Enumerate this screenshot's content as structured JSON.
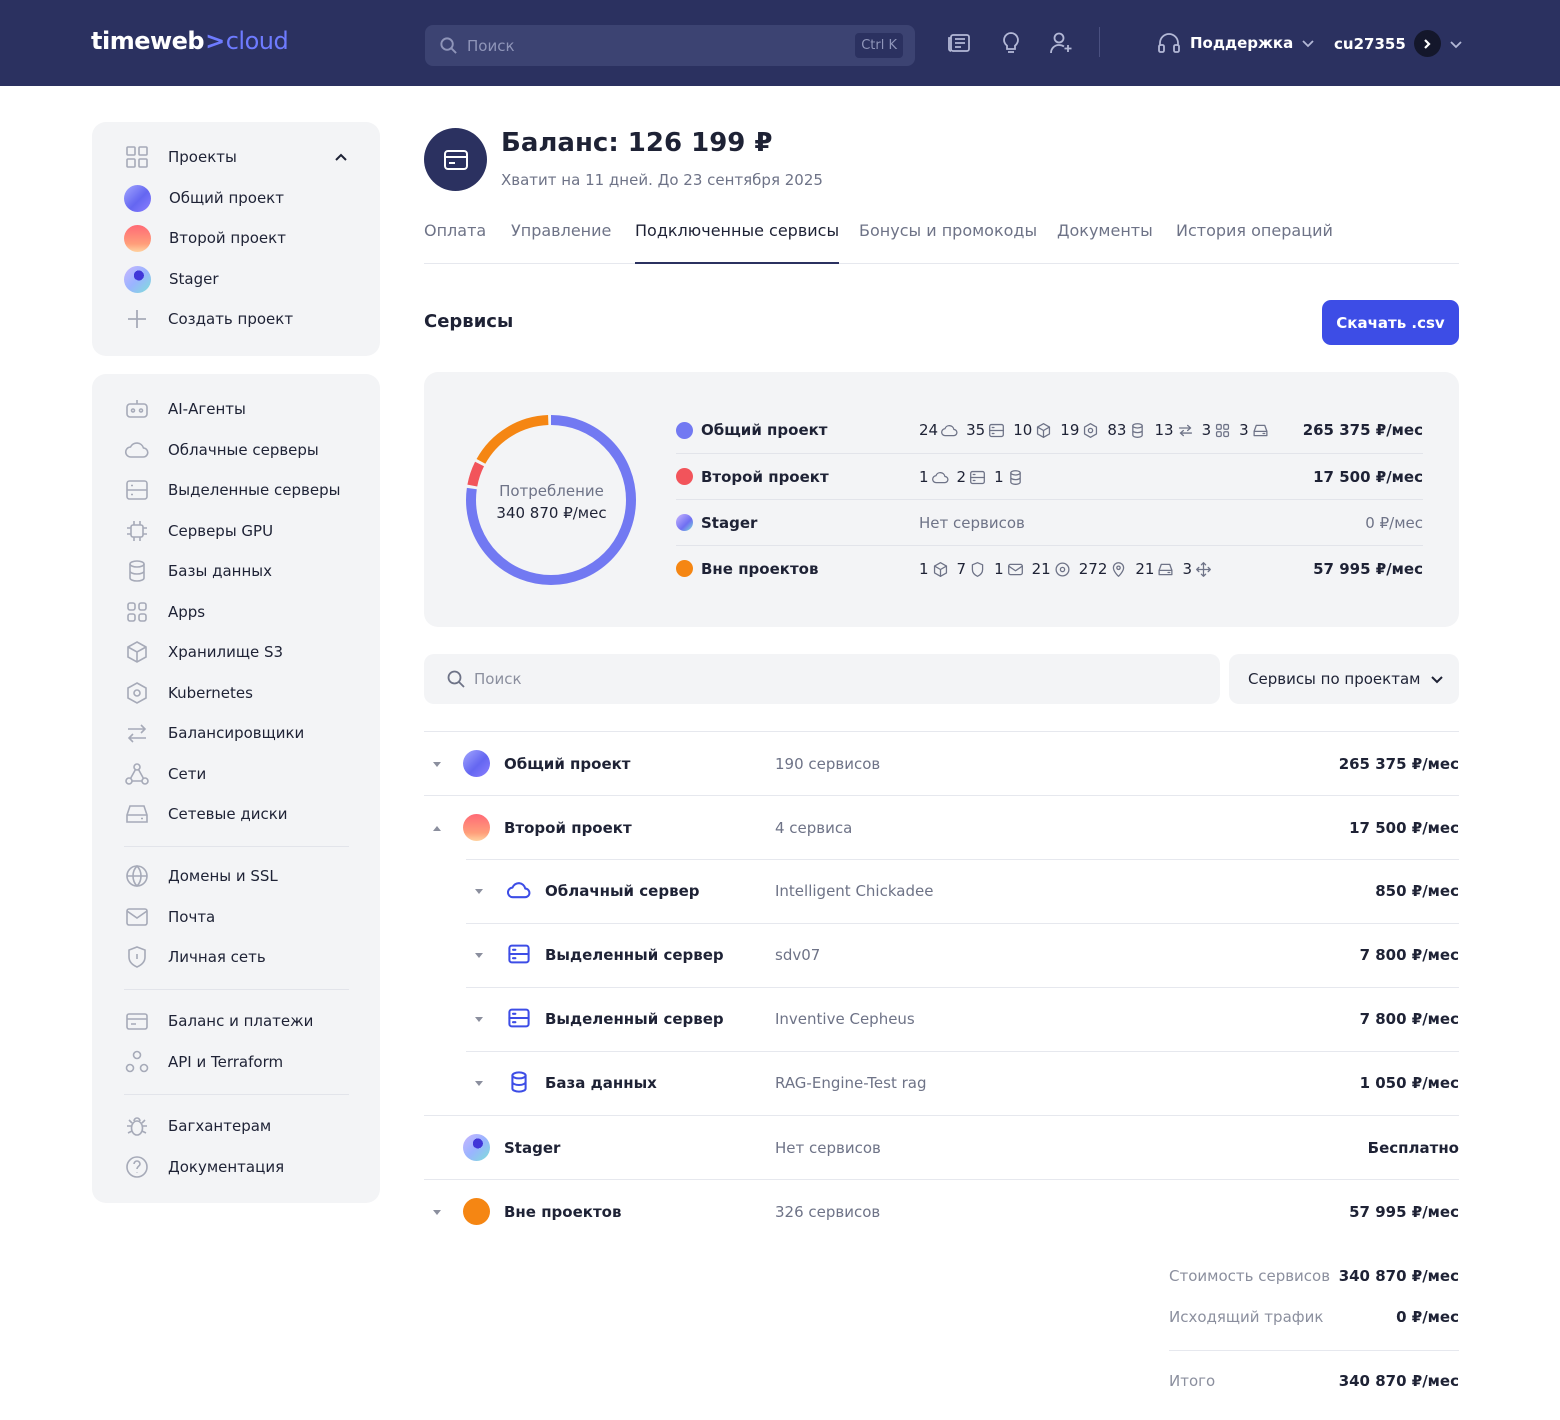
{
  "header": {
    "logo_main": "timeweb",
    "logo_arrow": ">",
    "logo_accent": "cloud",
    "search_placeholder": "Поиск",
    "search_shortcut": "Ctrl K",
    "icons": [
      "news-icon",
      "lightbulb-icon",
      "add-user-icon"
    ],
    "support_label": "Поддержка",
    "user_id": "cu27355"
  },
  "sidebar": {
    "projects_title": "Проекты",
    "projects": [
      {
        "label": "Общий проект",
        "avatar": "blue"
      },
      {
        "label": "Второй проект",
        "avatar": "red"
      },
      {
        "label": "Stager",
        "avatar": "stager"
      }
    ],
    "create_project": "Создать проект",
    "nav_groups": [
      [
        {
          "label": "AI-Агенты",
          "icon": "robot-icon"
        },
        {
          "label": "Облачные серверы",
          "icon": "cloud-icon"
        },
        {
          "label": "Выделенные серверы",
          "icon": "server-icon"
        },
        {
          "label": "Серверы GPU",
          "icon": "chip-icon"
        },
        {
          "label": "Базы данных",
          "icon": "database-icon"
        },
        {
          "label": "Apps",
          "icon": "apps-icon"
        },
        {
          "label": "Хранилище S3",
          "icon": "cube-icon"
        },
        {
          "label": "Kubernetes",
          "icon": "kubernetes-icon"
        },
        {
          "label": "Балансировщики",
          "icon": "arrows-icon"
        },
        {
          "label": "Сети",
          "icon": "network-icon"
        },
        {
          "label": "Сетевые диски",
          "icon": "disk-icon"
        }
      ],
      [
        {
          "label": "Домены и SSL",
          "icon": "globe-icon"
        },
        {
          "label": "Почта",
          "icon": "mail-icon"
        },
        {
          "label": "Личная сеть",
          "icon": "shield-icon"
        }
      ],
      [
        {
          "label": "Баланс и платежи",
          "icon": "card-icon"
        },
        {
          "label": "API и Terraform",
          "icon": "api-icon"
        }
      ],
      [
        {
          "label": "Багхантерам",
          "icon": "bug-icon"
        },
        {
          "label": "Документация",
          "icon": "help-icon"
        }
      ]
    ]
  },
  "balance": {
    "title": "Баланс: 126 199 ₽",
    "subtitle": "Хватит на 11 дней. До 23 сентября 2025"
  },
  "tabs": [
    "Оплата",
    "Управление",
    "Подключенные сервисы",
    "Бонусы и промокоды",
    "Документы",
    "История операций"
  ],
  "active_tab": "Подключенные сервисы",
  "services": {
    "title": "Сервисы",
    "download_button": "Скачать .csv"
  },
  "chart_data": {
    "type": "pie",
    "center_label": "Потребление",
    "center_value": "340 870 ₽/мес",
    "categories": [
      "Общий проект",
      "Второй проект",
      "Stager",
      "Вне проектов"
    ],
    "values": [
      265375,
      17500,
      0,
      57995
    ],
    "colors": [
      "#7279f2",
      "#f2545b",
      "#b8a8ff",
      "#f58613"
    ]
  },
  "summary": [
    {
      "name": "Общий проект",
      "color": "#7279f2",
      "counts": [
        [
          "24",
          "cloud-icon"
        ],
        [
          "35",
          "server-icon"
        ],
        [
          "10",
          "cube-icon"
        ],
        [
          "19",
          "kubernetes-icon"
        ],
        [
          "83",
          "database-icon"
        ],
        [
          "13",
          "arrows-icon"
        ],
        [
          "3",
          "apps-icon"
        ],
        [
          "3",
          "disk-icon"
        ]
      ],
      "price": "265 375 ₽/мес"
    },
    {
      "name": "Второй проект",
      "color": "#f2545b",
      "counts": [
        [
          "1",
          "cloud-icon"
        ],
        [
          "2",
          "server-icon"
        ],
        [
          "1",
          "database-icon"
        ]
      ],
      "price": "17 500 ₽/мес"
    },
    {
      "name": "Stager",
      "color": "#b8a8ff",
      "empty": "Нет сервисов",
      "price": "0 ₽/мес"
    },
    {
      "name": "Вне проектов",
      "color": "#f58613",
      "counts": [
        [
          "1",
          "cube-icon"
        ],
        [
          "7",
          "shield-icon"
        ],
        [
          "1",
          "mail-icon"
        ],
        [
          "21",
          "target-icon"
        ],
        [
          "272",
          "pin-icon"
        ],
        [
          "21",
          "disk-icon"
        ],
        [
          "3",
          "move-icon"
        ]
      ],
      "price": "57 995 ₽/мес"
    }
  ],
  "filter": {
    "search_placeholder": "Поиск",
    "group_select": "Сервисы по проектам"
  },
  "table": [
    {
      "name": "Общий проект",
      "meta": "190 сервисов",
      "price": "265 375 ₽/мес",
      "level": 0,
      "avatar": "blue",
      "caret": "down"
    },
    {
      "name": "Второй проект",
      "meta": "4 сервиса",
      "price": "17 500 ₽/мес",
      "level": 0,
      "avatar": "red",
      "caret": "up"
    },
    {
      "name": "Облачный сервер",
      "meta": "Intelligent Chickadee",
      "price": "850 ₽/мес",
      "level": 1,
      "icon": "cloud-icon",
      "caret": "down"
    },
    {
      "name": "Выделенный сервер",
      "meta": "sdv07",
      "price": "7 800 ₽/мес",
      "level": 1,
      "icon": "server-icon",
      "caret": "down"
    },
    {
      "name": "Выделенный сервер",
      "meta": "Inventive Cepheus",
      "price": "7 800 ₽/мес",
      "level": 1,
      "icon": "server-icon",
      "caret": "down"
    },
    {
      "name": "База данных",
      "meta": "RAG-Engine-Test rag",
      "price": "1 050 ₽/мес",
      "level": 1,
      "icon": "database-icon",
      "caret": "down"
    },
    {
      "name": "Stager",
      "meta": "Нет сервисов",
      "price": "Бесплатно",
      "level": 0,
      "avatar": "stager",
      "caret": "none"
    },
    {
      "name": "Вне проектов",
      "meta": "326 сервисов",
      "price": "57 995 ₽/мес",
      "level": 0,
      "avatar": "orange",
      "caret": "down"
    }
  ],
  "totals": {
    "services_cost_label": "Стоимость сервисов",
    "services_cost": "340 870 ₽/мес",
    "traffic_label": "Исходящий трафик",
    "traffic": "0 ₽/мес",
    "total_label": "Итого",
    "total": "340 870 ₽/мес"
  },
  "colors": {
    "header_bg": "#2b3160",
    "accent": "#3d4de6",
    "logo_accent": "#6e7bff",
    "card_bg": "#f3f4f6"
  }
}
